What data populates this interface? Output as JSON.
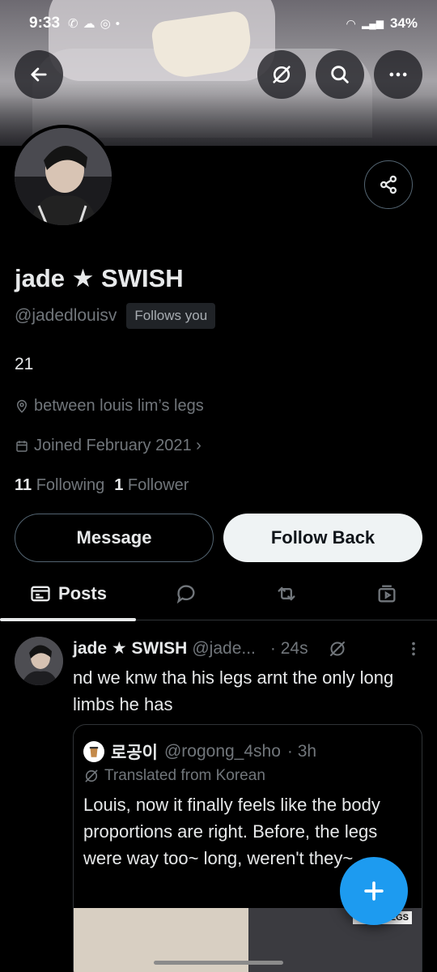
{
  "status_bar": {
    "time": "9:33",
    "battery": "34%"
  },
  "profile": {
    "name": "jade ★ SWISH",
    "handle": "@jadedlouisv",
    "follows_badge": "Follows you",
    "bio": "21",
    "location": "between louis lim’s legs",
    "joined": "Joined February 2021 ›",
    "following_count": "11",
    "following_label": "Following",
    "followers_count": "1",
    "followers_label": "Follower"
  },
  "actions": {
    "message_label": "Message",
    "follow_back_label": "Follow Back"
  },
  "tabs": {
    "posts_label": "Posts"
  },
  "tweet": {
    "name": "jade ★ SWISH",
    "handle": "@jade...",
    "time": "· 24s",
    "text": "nd we knw tha his legs arnt the only long limbs he has"
  },
  "quote": {
    "name": "로공이",
    "handle": "@rogong_4sho",
    "time": "· 3h",
    "translated": "Translated from Korean",
    "text": "Louis, now it finally feels like the body proportions are right. Before, the legs were way too~ long, weren't they~",
    "image_label": "LONG LEGS"
  },
  "colors": {
    "accent": "#1d9bf0",
    "background": "#000000",
    "muted": "#71767b"
  },
  "icons": [
    "back-arrow-icon",
    "no-signal-icon",
    "search-icon",
    "more-icon",
    "share-icon",
    "location-icon",
    "calendar-icon",
    "posts-icon",
    "replies-icon",
    "reposts-icon",
    "media-icon",
    "plus-icon"
  ]
}
